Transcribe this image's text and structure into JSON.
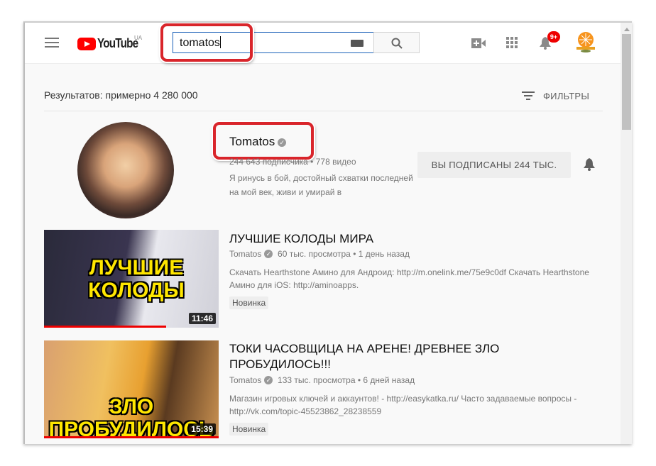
{
  "header": {
    "logo_text": "YouTube",
    "country": "UA",
    "search_value": "tomatos",
    "notification_count": "9+"
  },
  "results": {
    "count_label": "Результатов: примерно 4 280 000",
    "filters_label": "ФИЛЬТРЫ"
  },
  "channel": {
    "name": "Tomatos",
    "subscribers": "244 643 подписчика",
    "videos": "778 видео",
    "description": "Я ринусь в бой, достойный схватки последней на мой век, живи и умирай в",
    "subscribe_label": "ВЫ ПОДПИСАНЫ  244 ТЫС."
  },
  "videos": [
    {
      "title": "ЛУЧШИЕ КОЛОДЫ МИРА",
      "channel": "Tomatos",
      "views": "60 тыс. просмотра",
      "age": "1 день назад",
      "description": "Скачать Hearthstone Амино для Андроид: http://m.onelink.me/75e9c0df Скачать Hearthstone Амино для iOS: http://aminoapps.",
      "badge": "Новинка",
      "duration": "11:46",
      "thumb_text": "ЛУЧШИЕ КОЛОДЫ"
    },
    {
      "title": "ТОКИ ЧАСОВЩИЦА НА АРЕНЕ! ДРЕВНЕЕ ЗЛО ПРОБУДИЛОСЬ!!!",
      "channel": "Tomatos",
      "views": "133 тыс. просмотра",
      "age": "6 дней назад",
      "description": "Магазин игровых ключей и аккаунтов! - http://easykatka.ru/ Часто задаваемые вопросы - http://vk.com/topic-45523862_28238559",
      "badge": "Новинка",
      "duration": "15:39",
      "thumb_text": "ЗЛО ПРОБУДИЛОСЬ"
    }
  ],
  "colors": {
    "brand": "#ff0000",
    "highlight": "#d9252b",
    "search_border": "#1c62b9"
  }
}
